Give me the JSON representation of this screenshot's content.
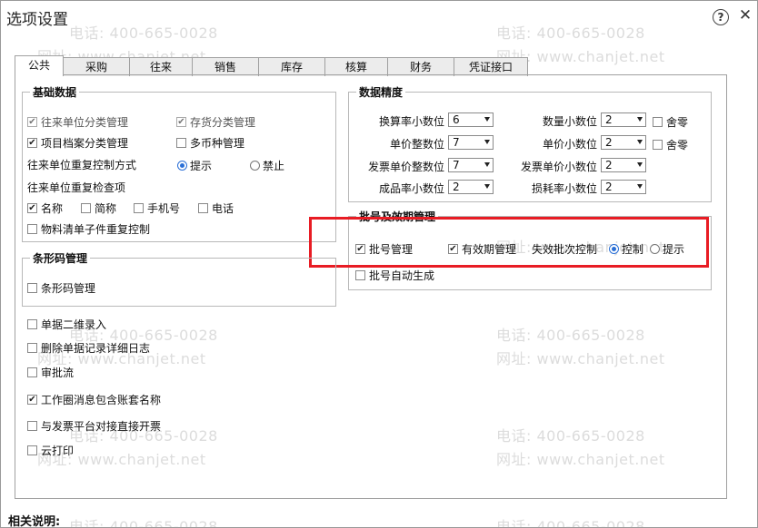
{
  "window": {
    "title": "选项设置"
  },
  "watermark": {
    "phone": "电话: 400-665-0028",
    "site": "网址: www.chanjet.net"
  },
  "tabs": [
    "公共",
    "采购",
    "往来",
    "销售",
    "库存",
    "核算",
    "财务",
    "凭证接口"
  ],
  "basic_data": {
    "title": "基础数据",
    "items": [
      {
        "label": "往来单位分类管理",
        "checked": true
      },
      {
        "label": "存货分类管理",
        "checked": true
      },
      {
        "label": "项目档案分类管理",
        "checked": true
      },
      {
        "label": "多币种管理",
        "checked": false
      }
    ],
    "dup_control_label": "往来单位重复控制方式",
    "radio_prompt": "提示",
    "radio_forbid": "禁止",
    "dup_check_label": "往来单位重复检查项",
    "check_items": [
      {
        "label": "名称",
        "checked": true
      },
      {
        "label": "简称",
        "checked": false
      },
      {
        "label": "手机号",
        "checked": false
      },
      {
        "label": "电话",
        "checked": false
      }
    ],
    "material_check": "物料清单子件重复控制"
  },
  "precision": {
    "title": "数据精度",
    "left": [
      {
        "label": "换算率小数位",
        "value": "6"
      },
      {
        "label": "单价整数位",
        "value": "7"
      },
      {
        "label": "发票单价整数位",
        "value": "7"
      },
      {
        "label": "成品率小数位",
        "value": "2"
      }
    ],
    "right": [
      {
        "label": "数量小数位",
        "value": "2",
        "round_label": "舍零"
      },
      {
        "label": "单价小数位",
        "value": "2",
        "round_label": "舍零"
      },
      {
        "label": "发票单价小数位",
        "value": "2"
      },
      {
        "label": "损耗率小数位",
        "value": "2"
      }
    ]
  },
  "batch": {
    "title": "批号及效期管理",
    "batch_mgmt": "批号管理",
    "expiry_mgmt": "有效期管理",
    "expired_control": "失效批次控制",
    "opt_control": "控制",
    "opt_prompt": "提示",
    "auto_gen": "批号自动生成"
  },
  "barcode": {
    "title": "条形码管理",
    "item": "条形码管理"
  },
  "misc": [
    {
      "label": "单据二维录入",
      "checked": false
    },
    {
      "label": "删除单据记录详细日志",
      "checked": false
    },
    {
      "label": "审批流",
      "checked": false
    },
    {
      "label": "工作圈消息包含账套名称",
      "checked": true
    },
    {
      "label": "与发票平台对接直接开票",
      "checked": false
    },
    {
      "label": "云打印",
      "checked": false
    }
  ],
  "footer": {
    "related_notes": "相关说明:"
  },
  "colors": {
    "highlight": "#e81c24",
    "radio_selected": "#2a6fd6"
  }
}
